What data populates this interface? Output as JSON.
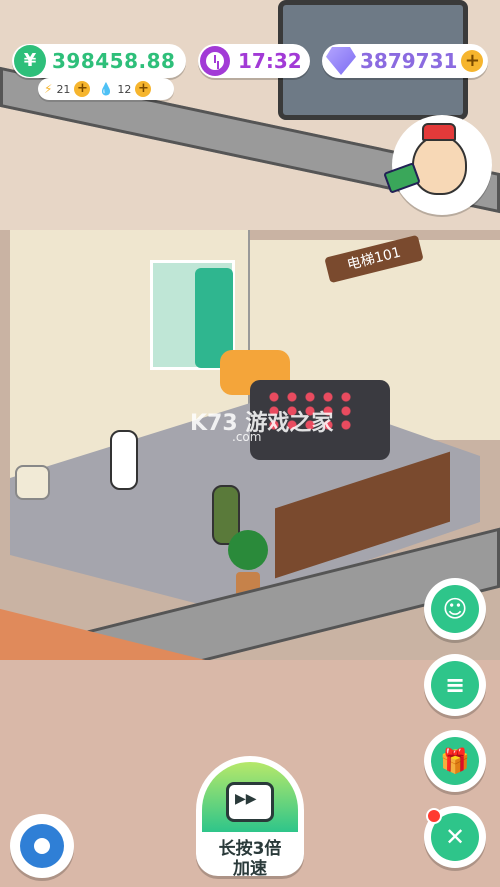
{
  "hud": {
    "money": {
      "icon": "yuan-icon",
      "value": "398458.88"
    },
    "energy": {
      "icon": "bolt-icon",
      "value": "21"
    },
    "water": {
      "icon": "drop-icon",
      "value": "12"
    },
    "time": {
      "icon": "clock-icon",
      "value": "17:32"
    },
    "gems": {
      "icon": "gem-icon",
      "value": "3879731"
    }
  },
  "scene": {
    "elevator_sign": "电梯101",
    "watermark": "K73 游戏之家",
    "watermark_sub": ".com"
  },
  "side_buttons": [
    {
      "name": "emoji-button",
      "icon": "smile-face-icon"
    },
    {
      "name": "tasks-button",
      "icon": "notepad-icon"
    },
    {
      "name": "gift-button",
      "icon": "gift-icon"
    },
    {
      "name": "tools-button",
      "icon": "tools-icon"
    }
  ],
  "speed_button": {
    "line1": "长按3倍",
    "line2": "加速"
  },
  "colors": {
    "accent_green": "#2ec58a",
    "money_green": "#2ebf7a",
    "time_purple": "#a23ad6",
    "gem_purple": "#8b6be0",
    "gold": "#f6b52e"
  }
}
